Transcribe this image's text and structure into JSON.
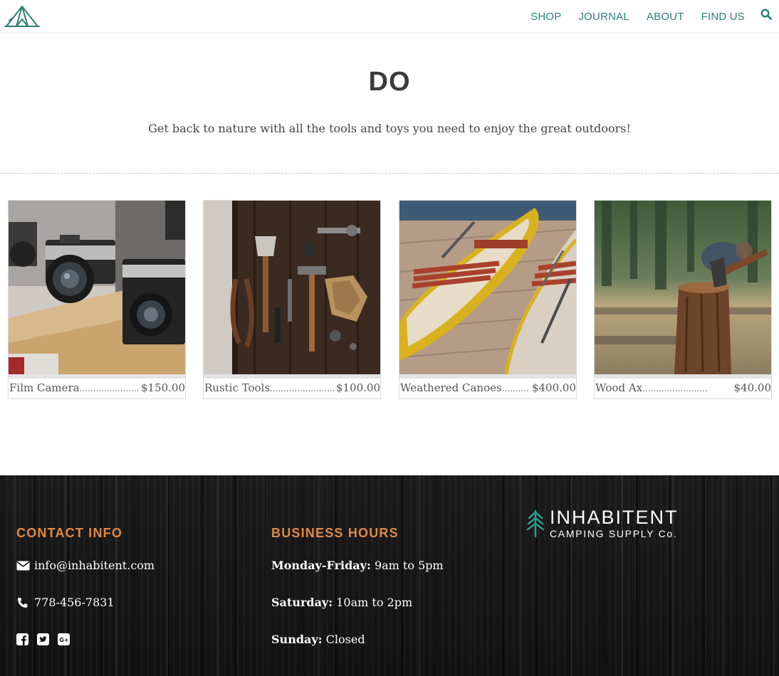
{
  "header": {
    "nav": [
      "SHOP",
      "JOURNAL",
      "ABOUT",
      "FIND US"
    ],
    "logo_icon": "tent-logo-icon",
    "search_icon": "search-icon",
    "accent": "#2c7f76"
  },
  "intro": {
    "title": "DO",
    "subtitle": "Get back to nature with all the tools and toys you need to enjoy the great outdoors!"
  },
  "products": [
    {
      "name": "Film Camera",
      "dots": "........................",
      "price": "$150.00",
      "image": "film-cameras-photo"
    },
    {
      "name": "Rustic Tools",
      "dots": "........................",
      "price": "$100.00",
      "image": "rustic-tools-photo"
    },
    {
      "name": "Weathered Canoes",
      "dots": "..........",
      "price": "$400.00",
      "image": "weathered-canoes-photo"
    },
    {
      "name": "Wood Ax",
      "dots": "........................",
      "price": "$40.00",
      "image": "wood-ax-photo"
    }
  ],
  "footer": {
    "contact": {
      "heading": "CONTACT INFO",
      "email": "info@inhabitent.com",
      "phone": "778-456-7831",
      "social_icons": [
        "facebook-icon",
        "twitter-icon",
        "google-plus-icon"
      ]
    },
    "hours": {
      "heading": "BUSINESS HOURS",
      "rows": [
        {
          "day": "Monday-Friday:",
          "time": "9am to 5pm"
        },
        {
          "day": "Saturday:",
          "time": "10am to 2pm"
        },
        {
          "day": "Sunday:",
          "time": "Closed"
        }
      ]
    },
    "brand": {
      "name": "INHABITENT",
      "tagline": "CAMPING SUPPLY Co.",
      "icon": "pine-tree-icon"
    },
    "heading_color": "#e08a45"
  }
}
